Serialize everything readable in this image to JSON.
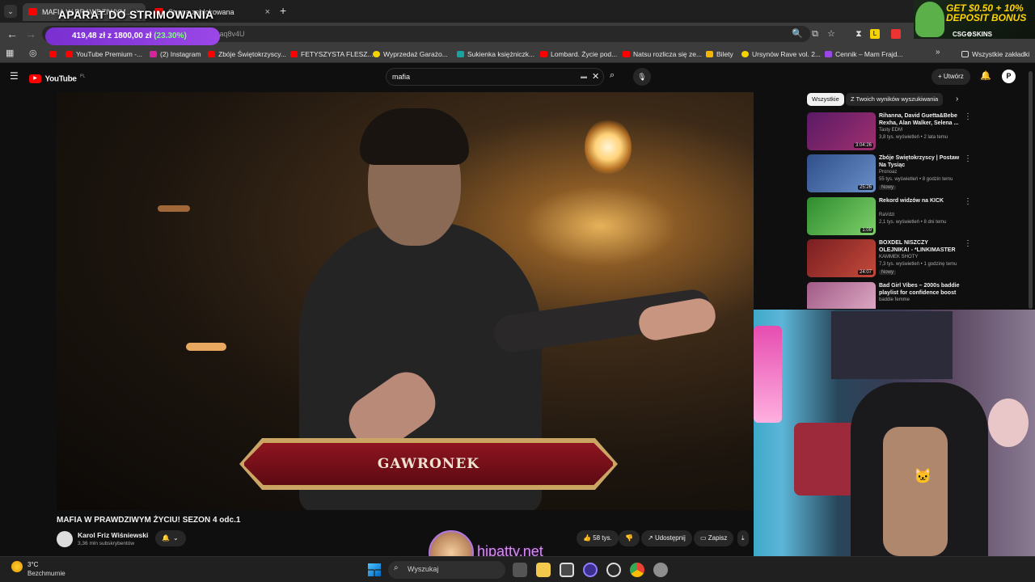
{
  "browser": {
    "tabs": [
      {
        "label": "MAFIA W PRAWDZIWYM..."
      },
      {
        "label": "Strona zablokowana"
      }
    ],
    "new_tab": "+",
    "url_fragment": "imaq8v4U"
  },
  "overlay": {
    "title": "APARAT DO STRIMOWANIA",
    "money_current": "419,48 zł",
    "money_sep": "z",
    "money_goal": "1800,00 zł",
    "money_pct": "(23.30%)"
  },
  "ad": {
    "line1": "GET $0.50 + 10%",
    "line2": "DEPOSIT BONUS",
    "brand": "CSG⚙SKINS"
  },
  "bookmarks": [
    {
      "label": "YouTube Premium -...",
      "color": "#ff0000"
    },
    {
      "label": "(2) Instagram",
      "color": "#d6249f"
    },
    {
      "label": "Zbóje Świętokrzyscy...",
      "color": "#ff0000"
    },
    {
      "label": "FETYSZYSTA FLESZ...",
      "color": "#ff0000"
    },
    {
      "label": "Wyprzedaż Garażo...",
      "color": "#f5d300"
    },
    {
      "label": "Sukienka księżniczk...",
      "color": "#18a2a0"
    },
    {
      "label": "Lombard. Życie pod...",
      "color": "#ff0000"
    },
    {
      "label": "Natsu rozlicza się ze...",
      "color": "#ff0000"
    },
    {
      "label": "Bilety",
      "color": "#f5b400"
    },
    {
      "label": "Ursynów Rave vol. 2...",
      "color": "#f5d300"
    },
    {
      "label": "Cennik – Mam Frajd...",
      "color": "#9b47e8"
    }
  ],
  "bookmarks_all": "Wszystkie zakładki",
  "youtube": {
    "logo": "YouTube",
    "region": "PL",
    "search_value": "mafia",
    "create_label": "Utwórz",
    "video": {
      "overlay_name": "GAWRONEK",
      "title": "MAFIA W PRAWDZIWYM ŻYCIU! SEZON 4 odc.1",
      "channel": "Karol Friz Wiśniewski",
      "subs": "3,36 mln subskrybentów",
      "likes": "58 tys.",
      "share": "Udostępnij",
      "save": "Zapisz"
    },
    "chips": [
      "Wszystkie",
      "Z Twoich wyników wyszukiwania"
    ],
    "recommendations": [
      {
        "title": "Rihanna, David Guetta&Bebe Rexha, Alan Walker, Selena ...",
        "channel": "Tasty EDM",
        "meta": "3,8 tys. wyświetleń • 2 lata temu",
        "duration": "3:04:26",
        "badge": "",
        "color": "#6b2a6e"
      },
      {
        "title": "Zbóje Świętokrzyscy | Postaw Na Tysiąc",
        "channel": "Pronoaz",
        "meta": "55 tys. wyświetleń • 8 godzin temu",
        "duration": "25:26",
        "badge": "Nowy",
        "color": "#2f4f8a"
      },
      {
        "title": "Rekord widzów na KICK",
        "channel": "RaVdzi",
        "meta": "2,1 tys. wyświetleń • 8 dni temu",
        "duration": "1:09",
        "badge": "",
        "color": "#3a9e3a"
      },
      {
        "title": "BOXDEL NISZCZY OLEJNIKA! - *LINKIMASTER VS BADUREK* ...",
        "channel": "KAMMEK SHOTY",
        "meta": "7,3 tys. wyświetleń • 1 godzinę temu",
        "duration": "24:07",
        "badge": "Nowy",
        "color": "#7a1e22"
      },
      {
        "title": "Bad Girl Vibes – 2000s baddie playlist for confidence boost –...",
        "channel": "baddie femme",
        "meta": "",
        "duration": "",
        "badge": "",
        "color": "#a05a86"
      }
    ]
  },
  "streamer": {
    "site": "hipatty.net"
  },
  "taskbar": {
    "temp": "3°C",
    "weather": "Bezchmurnie",
    "search_placeholder": "Wyszukaj"
  }
}
